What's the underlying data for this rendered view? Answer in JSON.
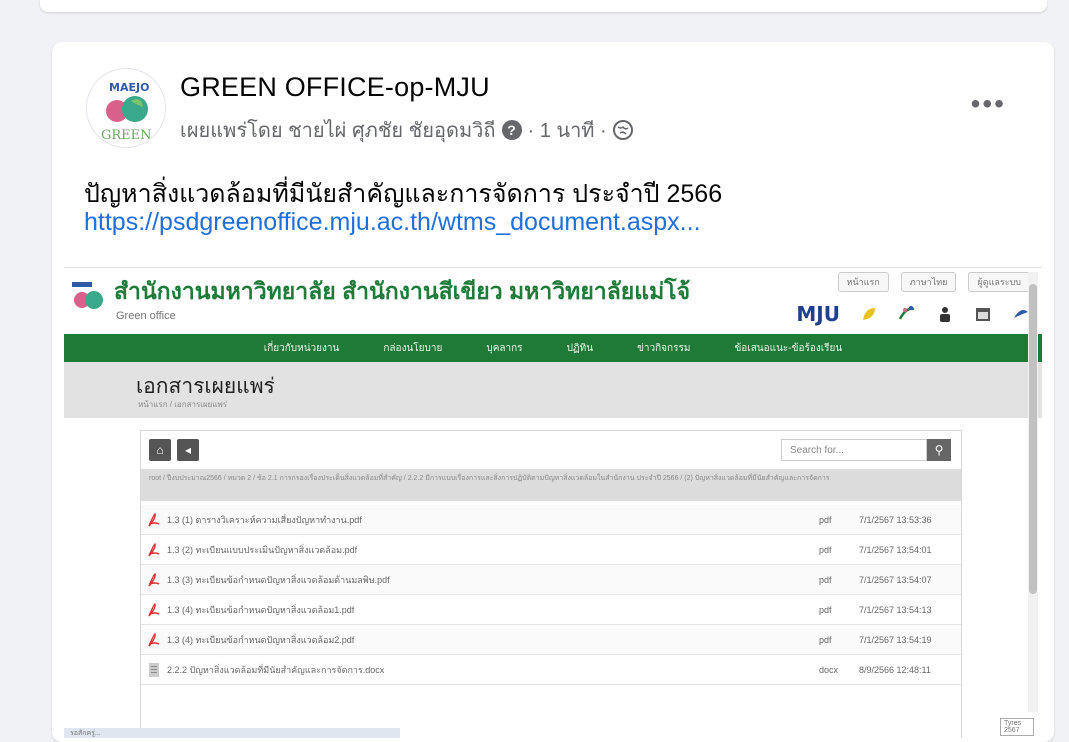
{
  "post": {
    "page_name": "GREEN OFFICE-op-MJU",
    "published_by": "เผยแพร่โดย ชายไผ่ ศุภชัย ชัยอุดมวิถี",
    "time": "· 1 นาที ·",
    "verified_glyph": "?",
    "more_label": "•••",
    "text": "ปัญหาสิ่งแวดล้อมที่มีนัยสำคัญและการจัดการ ประจำปี 2566",
    "link": "https://psdgreenoffice.mju.ac.th/wtms_document.aspx..."
  },
  "avatar": {
    "logo_text": "MAEJO",
    "logo_sub": "GREEN"
  },
  "site": {
    "title": "สำนักงานมหาวิทยาลัย สำนักงานสีเขียว มหาวิทยาลัยแม่โจ้",
    "subtitle": "Green office",
    "top_links": [
      "หน้าแรก",
      "ภาษาไทย",
      "ผู้ดูแลระบบ"
    ],
    "mju_logo": "MJU",
    "nav": [
      "เกี่ยวกับหน่วยงาน",
      "กล่องนโยบาย",
      "บุคลากร",
      "ปฏิทิน",
      "ข่าวกิจกรรม",
      "ข้อเสนอแนะ-ข้อร้องเรียน"
    ],
    "banner_title": "เอกสารเผยแพร่",
    "banner_crumb": "หน้าแรก / เอกสารเผยแพร่",
    "home_glyph": "⌂",
    "back_glyph": "◂",
    "search_placeholder": "Search for...",
    "search_glyph": "⚲",
    "path_text": "root / ปีงบประมาณ2566 / หมวด 2 / ข้อ 2.1 การกรองเรื่องประเด็นสิ่งแวดล้อมที่สำคัญ / 2.2.2 มีการแบบเรื่องการและสิ่งการปฏิบัติตามปัญหาสิ่งแวดล้อมในสำนักงาน ประจำปี 2566 / (2) ปัญหาสิ่งแวดล้อมที่มีนัยสำคัญและการจัดการ",
    "files": [
      {
        "name": "1.3 (1) ตารางวิเคราะห์ความเสี่ยงปัญหาทำงาน.pdf",
        "type": "pdf",
        "date": "7/1/2567 13:53:36"
      },
      {
        "name": "1.3 (2) ทะเบียนแบบประเมินปัญหาสิ่งแวดล้อม.pdf",
        "type": "pdf",
        "date": "7/1/2567 13:54:01"
      },
      {
        "name": "1.3 (3) ทะเบียนข้อกำหนดปัญหาสิ่งแวดล้อมด้านมลพิษ.pdf",
        "type": "pdf",
        "date": "7/1/2567 13:54:07"
      },
      {
        "name": "1.3 (4) ทะเบียนข้อกำหนดปัญหาสิ่งแวดล้อม1.pdf",
        "type": "pdf",
        "date": "7/1/2567 13:54:13"
      },
      {
        "name": "1.3 (4) ทะเบียนข้อกำหนดปัญหาสิ่งแวดล้อม2.pdf",
        "type": "pdf",
        "date": "7/1/2567 13:54:19"
      },
      {
        "name": "2.2.2 ปัญหาสิ่งแวดล้อมที่มีนัยสำคัญและการจัดการ.docx",
        "type": "docx",
        "date": "8/9/2566 12:48:11"
      }
    ],
    "status_text": "รอสักครู่...",
    "corner_note": "Tyres 2567"
  },
  "colors": {
    "site_green": "#1f7a37",
    "link_blue": "#216fdb"
  }
}
